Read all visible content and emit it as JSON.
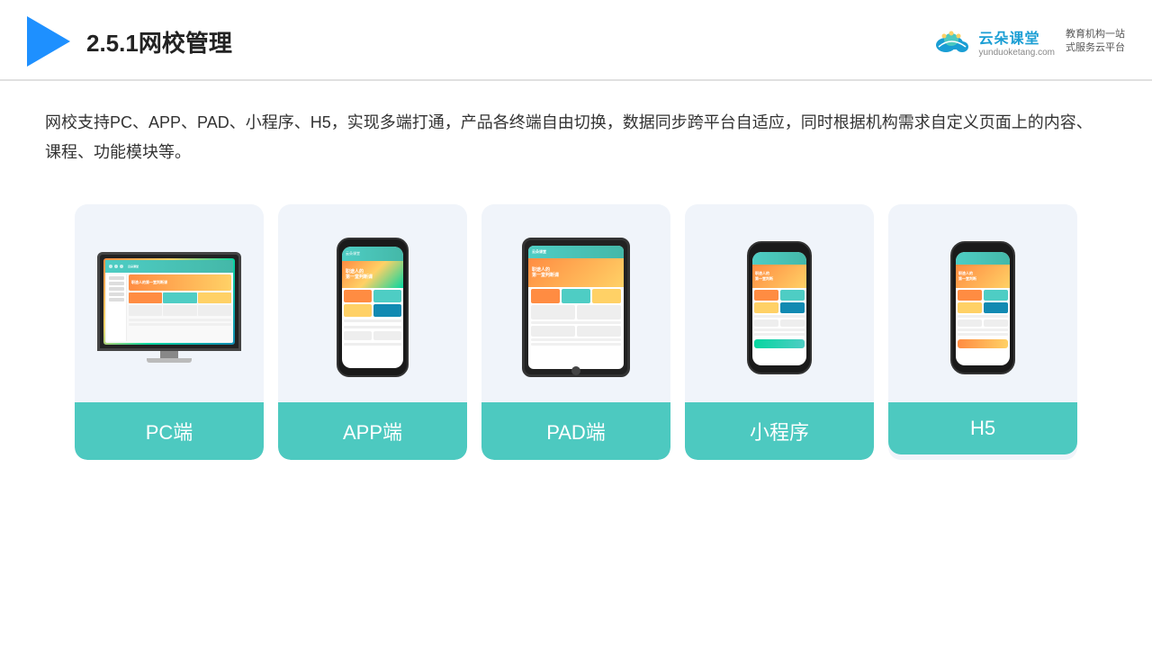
{
  "header": {
    "title": "2.5.1网校管理",
    "brand": {
      "name": "云朵课堂",
      "url": "yunduoketang.com",
      "slogan": "教育机构一站\n式服务云平台"
    }
  },
  "description": {
    "text": "网校支持PC、APP、PAD、小程序、H5，实现多端打通，产品各终端自由切换，数据同步跨平台自适应，同时根据机构需求自定义页面上的内容、课程、功能模块等。"
  },
  "cards": [
    {
      "id": "pc",
      "label": "PC端"
    },
    {
      "id": "app",
      "label": "APP端"
    },
    {
      "id": "pad",
      "label": "PAD端"
    },
    {
      "id": "miniapp",
      "label": "小程序"
    },
    {
      "id": "h5",
      "label": "H5"
    }
  ],
  "colors": {
    "accent": "#4DC9C0",
    "triangle": "#1E90FF",
    "brand": "#1a9ed4"
  }
}
